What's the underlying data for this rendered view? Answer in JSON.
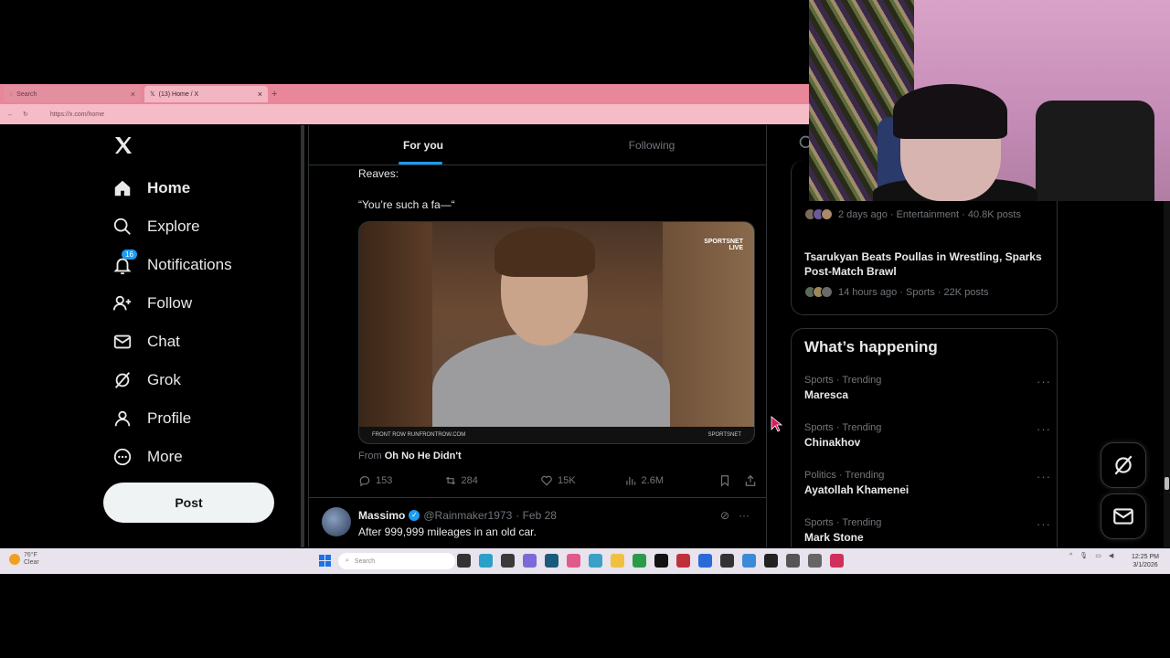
{
  "browser": {
    "tabs": [
      {
        "label": "Search",
        "active": false
      },
      {
        "label": "(13) Home / X",
        "active": true
      }
    ],
    "url": "https://x.com/home"
  },
  "nav": {
    "items": [
      {
        "label": "Home",
        "icon": "home-icon",
        "active": true
      },
      {
        "label": "Explore",
        "icon": "search-icon"
      },
      {
        "label": "Notifications",
        "icon": "bell-icon",
        "badge": "16"
      },
      {
        "label": "Follow",
        "icon": "follow-icon"
      },
      {
        "label": "Chat",
        "icon": "mail-icon"
      },
      {
        "label": "Grok",
        "icon": "grok-icon"
      },
      {
        "label": "Profile",
        "icon": "person-icon"
      },
      {
        "label": "More",
        "icon": "more-circle-icon"
      }
    ],
    "post_label": "Post"
  },
  "feed": {
    "tabs": [
      {
        "label": "For you",
        "active": true
      },
      {
        "label": "Following",
        "active": false
      }
    ],
    "tweet": {
      "line1": "Reaves:",
      "line2": "“You’re such a fa—“",
      "media_logo_top": "SPORTSNET",
      "media_logo_sub": "LIVE",
      "media_ticker_left": "FRONT ROW RUNFRONTROW.COM",
      "media_ticker_right": "SPORTSNET",
      "source_prefix": "From",
      "source_name": "Oh No He Didn't",
      "replies": "153",
      "reposts": "284",
      "likes": "15K",
      "views": "2.6M"
    },
    "next_tweet": {
      "name": "Massimo",
      "handle": "@Rainmaker1973",
      "date": "· Feb 28",
      "text": "After 999,999 mileages in an old car."
    }
  },
  "right": {
    "top_items": [
      {
        "meta": "2 days ago · Entertainment · 40.8K posts"
      },
      {
        "title": "Tsarukyan Beats Poullas in Wrestling, Sparks Post-Match Brawl",
        "meta": "14 hours ago · Sports · 22K posts"
      }
    ],
    "whats_happening": "What’s happening",
    "trends": [
      {
        "category": "Sports · Trending",
        "name": "Maresca"
      },
      {
        "category": "Sports · Trending",
        "name": "Chinakhov"
      },
      {
        "category": "Politics · Trending",
        "name": "Ayatollah Khamenei"
      },
      {
        "category": "Sports · Trending",
        "name": "Mark Stone"
      }
    ]
  },
  "taskbar": {
    "weather_temp": "76°F",
    "weather_desc": "Clear",
    "search_placeholder": "Search",
    "time": "12:25 PM",
    "date": "3/1/2026"
  },
  "colors": {
    "accent": "#1d9bf0",
    "tab_bar": "#e8879a",
    "background": "#000000"
  }
}
